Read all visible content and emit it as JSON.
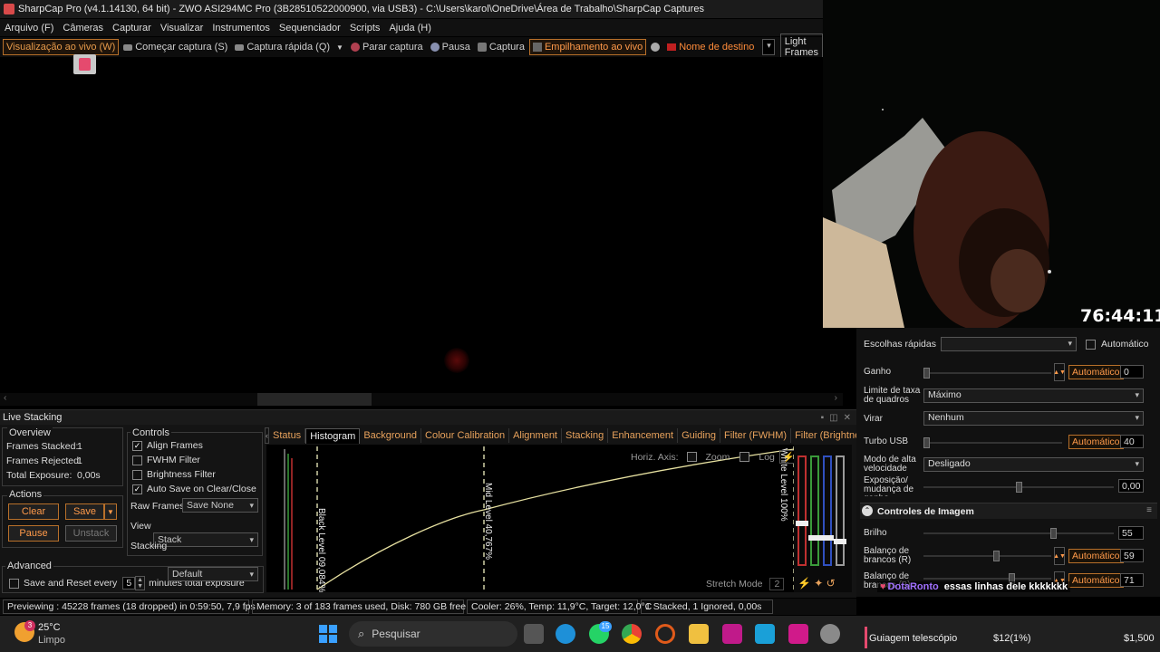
{
  "window": {
    "title": "SharpCap Pro (v4.1.14130, 64 bit) - ZWO ASI294MC Pro (3B28510522000900, via USB3) - C:\\Users\\karol\\OneDrive\\Área de Trabalho\\SharpCap Captures"
  },
  "menu": [
    "Arquivo (F)",
    "Câmeras",
    "Capturar",
    "Visualizar",
    "Instrumentos",
    "Sequenciador",
    "Scripts",
    "Ajuda (H)"
  ],
  "toolbar": {
    "live_view": "Visualização ao vivo (W)",
    "start_capture": "Começar captura (S)",
    "quick_capture": "Captura rápida (Q)",
    "stop_capture": "Parar captura",
    "pause": "Pausa",
    "capture": "Captura",
    "live_stacking": "Empilhamento ao vivo",
    "target_name": "Nome de destino",
    "target_value": "",
    "light_frames": "Light Frames"
  },
  "live_stacking": {
    "title": "Live Stacking",
    "overview": {
      "label": "Overview",
      "frames_stacked_label": "Frames Stacked:",
      "frames_stacked": "1",
      "frames_rejected_label": "Frames Rejected:",
      "frames_rejected": "1",
      "total_exposure_label": "Total Exposure:",
      "total_exposure": "0,00s"
    },
    "actions": {
      "label": "Actions",
      "clear": "Clear",
      "save": "Save",
      "pause": "Pause",
      "unstack": "Unstack"
    },
    "advanced": {
      "label": "Advanced",
      "save_reset_label": "Save and Reset every",
      "save_reset_value": "5",
      "save_reset_suffix": "minutes total exposure"
    },
    "controls": {
      "label": "Controls",
      "align_frames": "Align Frames",
      "fwhm_filter": "FWHM Filter",
      "brightness_filter": "Brightness Filter",
      "auto_save": "Auto Save on Clear/Close",
      "raw_frames_label": "Raw Frames",
      "raw_frames_value": "Save None",
      "view_label": "View",
      "view_value": "Stack",
      "stacking_label": "Stacking",
      "stacking_value": "Default"
    },
    "tabs": [
      "Status",
      "Histogram",
      "Background",
      "Colour Calibration",
      "Alignment",
      "Stacking",
      "Enhancement",
      "Guiding",
      "Filter (FWHM)",
      "Filter (Brightness)"
    ],
    "selected_tab": "Histogram",
    "histogram": {
      "horiz_axis_label": "Horiz. Axis:",
      "zoom_label": "Zoom",
      "log_label": "Log",
      "black_level": "Black Level 09,084%",
      "mid_level": "Mid Level 40,767%",
      "white_level": "White Level 100%",
      "stretch_mode": "Stretch Mode",
      "stretch_value": "2"
    }
  },
  "status_bar": {
    "previewing": "Previewing : 45228 frames (18 dropped) in 0:59:50, 7,9 fps",
    "memory": "Memory: 3 of 183 frames used, Disk: 780 GB free",
    "cooler": "Cooler: 26%, Temp: 11,9°C, Target: 12,0°C",
    "stacked": "1 Stacked, 1 Ignored, 0,00s"
  },
  "overlay": {
    "timer": "76:44:11",
    "chat_user": "DotaRonto",
    "chat_message": "essas linhas dele kkkkkkk"
  },
  "camera_controls": {
    "quick_picks_label": "Escolhas rápidas",
    "quick_picks_value": "",
    "automatic_label": "Automático",
    "gain_label": "Ganho",
    "gain_auto": "Automático",
    "gain_value": "0",
    "frame_limit_label": "Limite de taxa de quadros",
    "frame_limit_value": "Máximo",
    "flip_label": "Virar",
    "flip_value": "Nenhum",
    "turbo_label": "Turbo USB",
    "turbo_auto": "Automático",
    "turbo_value": "40",
    "high_speed_label": "Modo de alta velocidade",
    "high_speed_value": "Desligado",
    "exposure_gain_label": "Exposição/ mudança de ganho",
    "exposure_gain_value": "0,00",
    "image_controls_title": "Controles de Imagem",
    "brightness_label": "Brilho",
    "brightness_value": "55",
    "wb_r_label": "Balanço de brancos (R)",
    "wb_r_auto": "Automático",
    "wb_r_value": "59",
    "wb_b_label": "Balanço de brancos (B)",
    "wb_b_auto": "Automático",
    "wb_b_value": "71"
  },
  "taskbar": {
    "weather_temp": "25°C",
    "weather_text": "Limpo",
    "weather_badge": "3",
    "search_placeholder": "Pesquisar",
    "whatsapp_badge": "15",
    "window_title": "Guiagem telescópio",
    "stock_change": "$12(1%)",
    "stock_price": "$1,500"
  },
  "colors": {
    "accent_orange": "#ff8c3a",
    "tab_text": "#e8a25c",
    "histogram_curve": "#e6e0a0"
  }
}
